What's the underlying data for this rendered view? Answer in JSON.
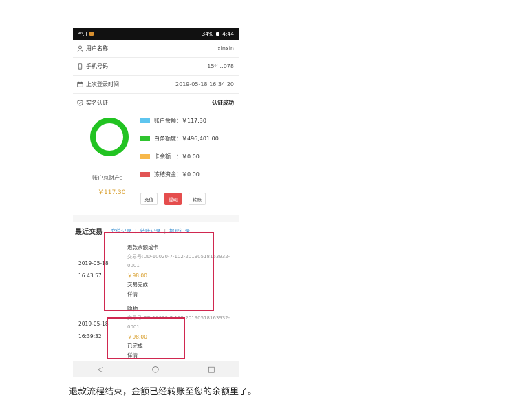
{
  "status_bar": {
    "left": "⁴⁶.ıl",
    "battery": "34%",
    "time": "4:44"
  },
  "profile": {
    "username_label": "用户名称",
    "username_value": "xinxin",
    "phone_label": "手机号码",
    "phone_value": "15⁰'    ‥078",
    "last_login_label": "上次登录时间",
    "last_login_value": "2019-05-18 16:34:20",
    "realname_label": "实名认证",
    "realname_value": "认证成功"
  },
  "assets": {
    "total_label": "账户总财产：",
    "total_value": "￥117.30",
    "legend": [
      {
        "label": "账户余额：￥117.30",
        "color": "#5ec5ef"
      },
      {
        "label": "白条额度：￥496,401.00",
        "color": "#2fc42f"
      },
      {
        "label": "卡余额　：￥0.00",
        "color": "#f7b84a"
      },
      {
        "label": "冻结资金：￥0.00",
        "color": "#e25555"
      }
    ],
    "ring_color": "#22c322",
    "buttons": {
      "recharge": "充值",
      "withdraw": "提现",
      "transfer": "转账"
    }
  },
  "recent": {
    "title": "最近交易",
    "links": [
      "充值记录",
      "转账记录",
      "提现记录"
    ],
    "separator": "|",
    "transactions": [
      {
        "date": "2019-05-18",
        "time": "16:43:57",
        "title": "退款余额或卡",
        "order_line1": "交易号:DD-10020-7-102-20190518163932-",
        "order_line2": "0001",
        "amount": "￥98.00",
        "status": "交易完成",
        "detail": "详情"
      },
      {
        "date": "2019-05-18",
        "time": "16:39:32",
        "title": "购物",
        "order_line1": "交易号:DD-10020-7-102-20190518163932-",
        "order_line2": "0001",
        "amount": "￥98.00",
        "status": "已完成",
        "detail": "详情"
      }
    ]
  },
  "nav": {
    "back": "◁",
    "home": "○",
    "recent": "□"
  },
  "caption": "退款流程结束，金额已经转账至您的余额里了。"
}
